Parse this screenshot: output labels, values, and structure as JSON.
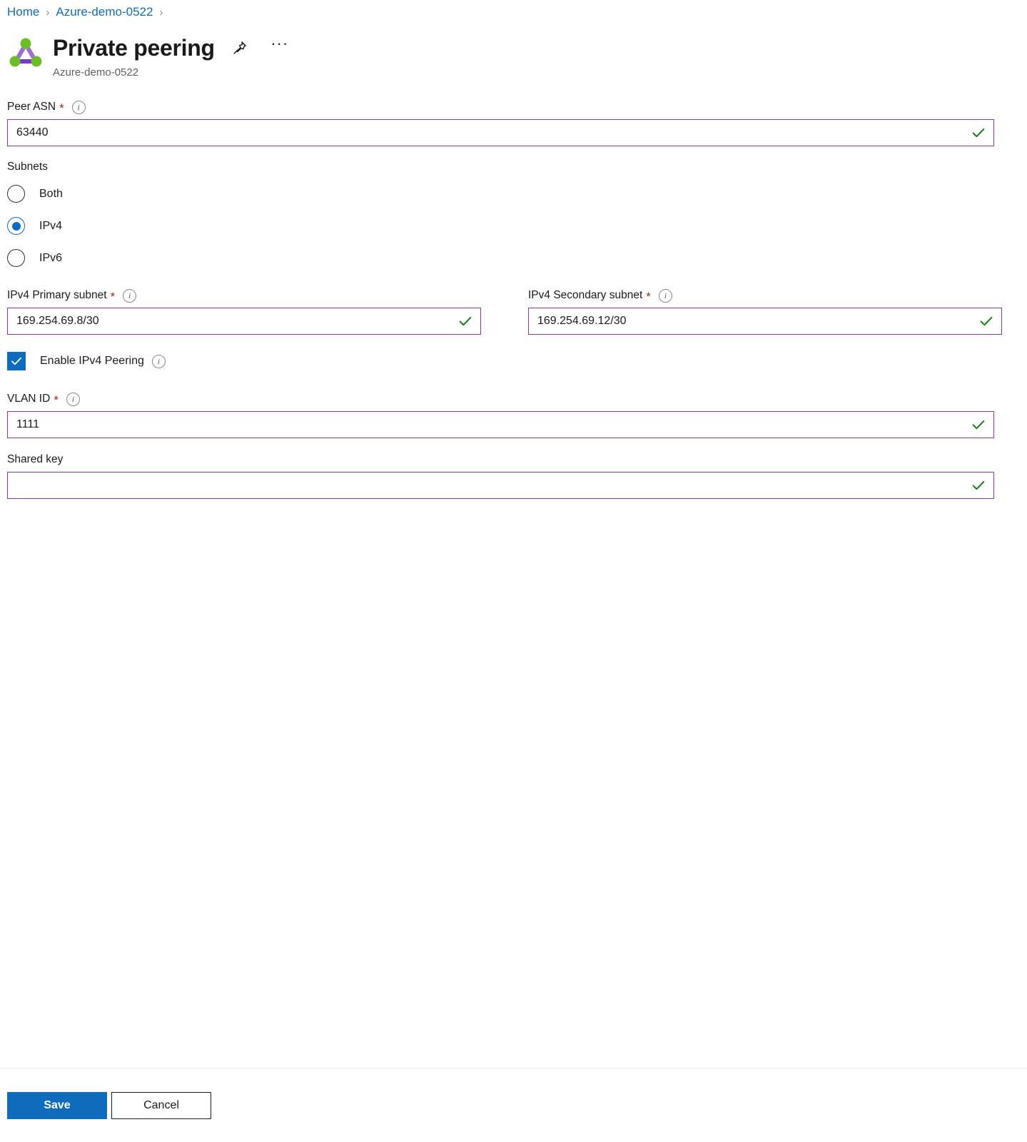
{
  "breadcrumb": {
    "items": [
      {
        "label": "Home"
      },
      {
        "label": "Azure-demo-0522"
      }
    ],
    "separator": "›"
  },
  "header": {
    "title": "Private peering",
    "subtitle": "Azure-demo-0522",
    "pin_icon": "pin-icon",
    "more_icon": "ellipsis-icon",
    "more_label": "···",
    "resource_icon": "expressroute-peering-icon"
  },
  "form": {
    "peer_asn": {
      "label": "Peer ASN",
      "required_mark": "*",
      "info_glyph": "i",
      "value": "63440",
      "placeholder": "",
      "valid": true
    },
    "subnets": {
      "label": "Subnets",
      "options": [
        {
          "label": "Both",
          "selected": false
        },
        {
          "label": "IPv4",
          "selected": true
        },
        {
          "label": "IPv6",
          "selected": false
        }
      ]
    },
    "ipv4_primary": {
      "label": "IPv4 Primary subnet",
      "required_mark": "*",
      "info_glyph": "i",
      "value": "169.254.69.8/30",
      "placeholder": "",
      "valid": true
    },
    "ipv4_secondary": {
      "label": "IPv4 Secondary subnet",
      "required_mark": "*",
      "info_glyph": "i",
      "value": "169.254.69.12/30",
      "placeholder": "",
      "valid": true
    },
    "enable_ipv4_peering": {
      "label": "Enable IPv4 Peering",
      "info_glyph": "i",
      "checked": true
    },
    "vlan_id": {
      "label": "VLAN ID",
      "required_mark": "*",
      "info_glyph": "i",
      "value": "1111",
      "placeholder": "",
      "valid": true
    },
    "shared_key": {
      "label": "Shared key",
      "value": "",
      "placeholder": "",
      "valid": true
    }
  },
  "footer": {
    "save_label": "Save",
    "cancel_label": "Cancel"
  },
  "colors": {
    "link": "#0f6cbd",
    "accent": "#0f6cbd",
    "input_border": "#8c37a8",
    "valid_check": "#107c10",
    "required": "#a4262c",
    "icon_node": "#6bbd2a",
    "icon_edge": "#9b6fd6"
  }
}
